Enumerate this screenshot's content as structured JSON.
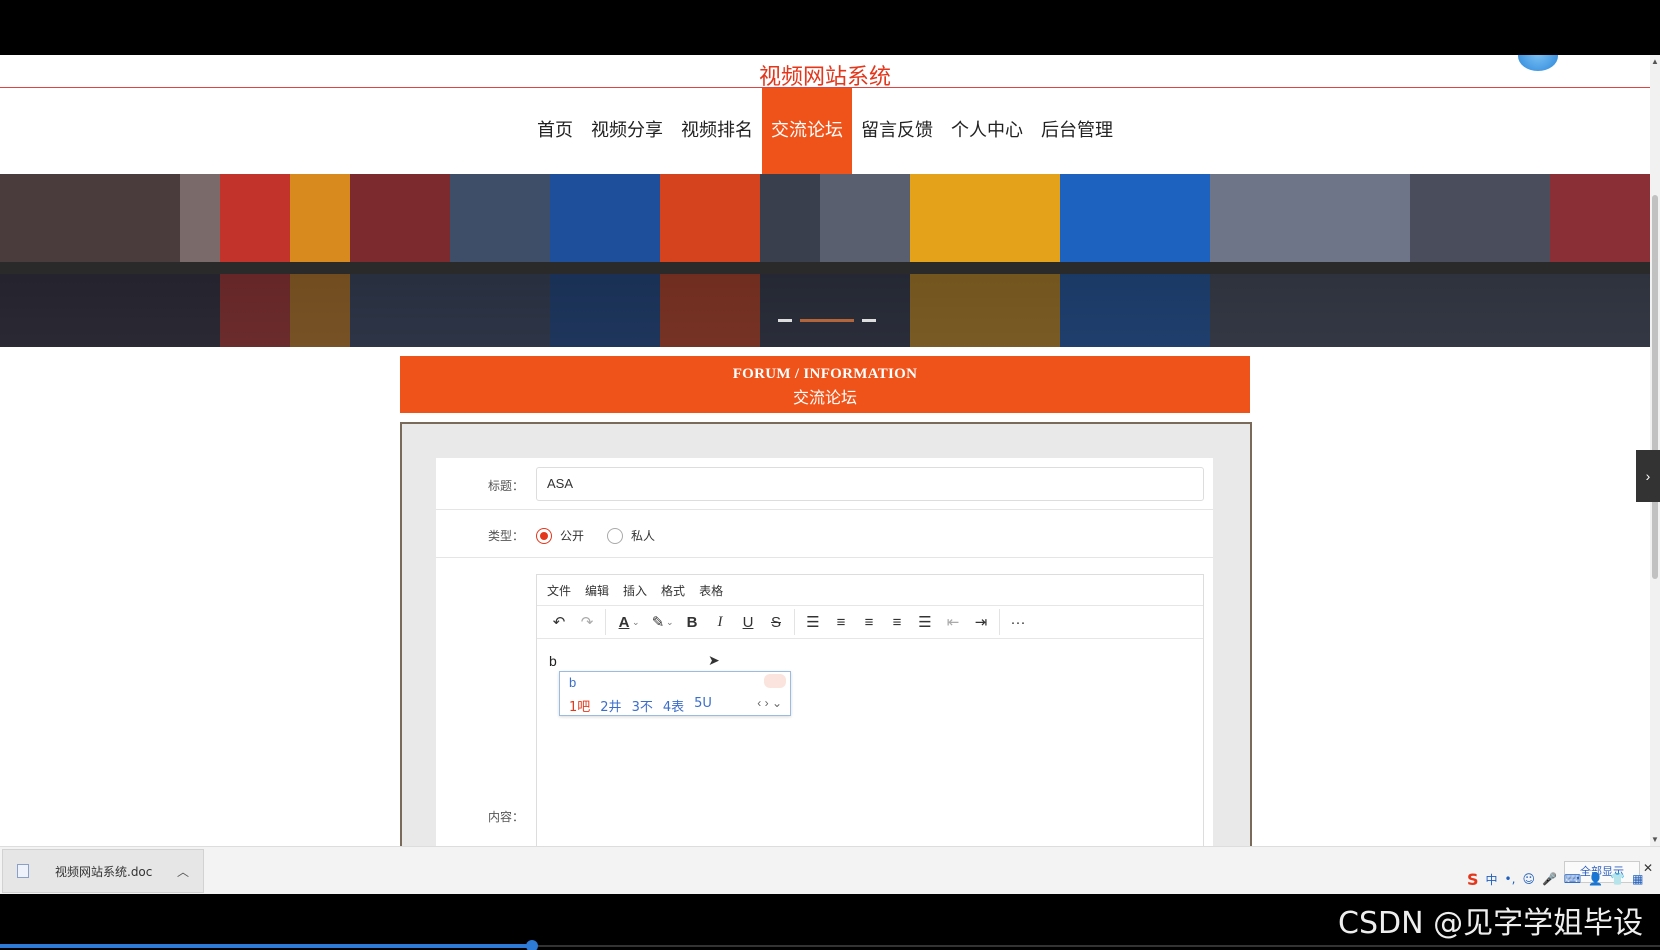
{
  "site": {
    "title": "视频网站系统"
  },
  "nav": {
    "items": [
      {
        "label": "首页"
      },
      {
        "label": "视频分享"
      },
      {
        "label": "视频排名"
      },
      {
        "label": "交流论坛",
        "active": true
      },
      {
        "label": "留言反馈"
      },
      {
        "label": "个人中心"
      },
      {
        "label": "后台管理"
      }
    ]
  },
  "section": {
    "title_en": "FORUM / INFORMATION",
    "title_zh": "交流论坛"
  },
  "form": {
    "title_label": "标题：",
    "title_value": "ASA",
    "type_label": "类型：",
    "type_options": [
      {
        "label": "公开",
        "checked": true
      },
      {
        "label": "私人",
        "checked": false
      }
    ],
    "content_label": "内容："
  },
  "editor": {
    "menu": [
      "文件",
      "编辑",
      "插入",
      "格式",
      "表格"
    ],
    "typed_text": "b",
    "toolbar_icons": [
      "undo-icon",
      "redo-icon",
      "font-color-icon",
      "highlight-icon",
      "bold-icon",
      "italic-icon",
      "underline-icon",
      "strikethrough-icon",
      "line-height-icon",
      "align-left-icon",
      "align-center-icon",
      "align-right-icon",
      "align-justify-icon",
      "outdent-icon",
      "indent-icon",
      "more-icon"
    ]
  },
  "ime_popup": {
    "code": "b",
    "candidates": [
      "1吧",
      "2井",
      "3不",
      "4表",
      "5U"
    ]
  },
  "download_bar": {
    "file_name": "视频网站系统.doc",
    "show_all": "全部显示"
  },
  "ime_tray": {
    "mode": "中"
  },
  "watermark": "CSDN @见字学姐毕设",
  "colors": {
    "accent": "#f0531a",
    "title_red": "#e4361b",
    "link_blue": "#2d5fbf"
  }
}
